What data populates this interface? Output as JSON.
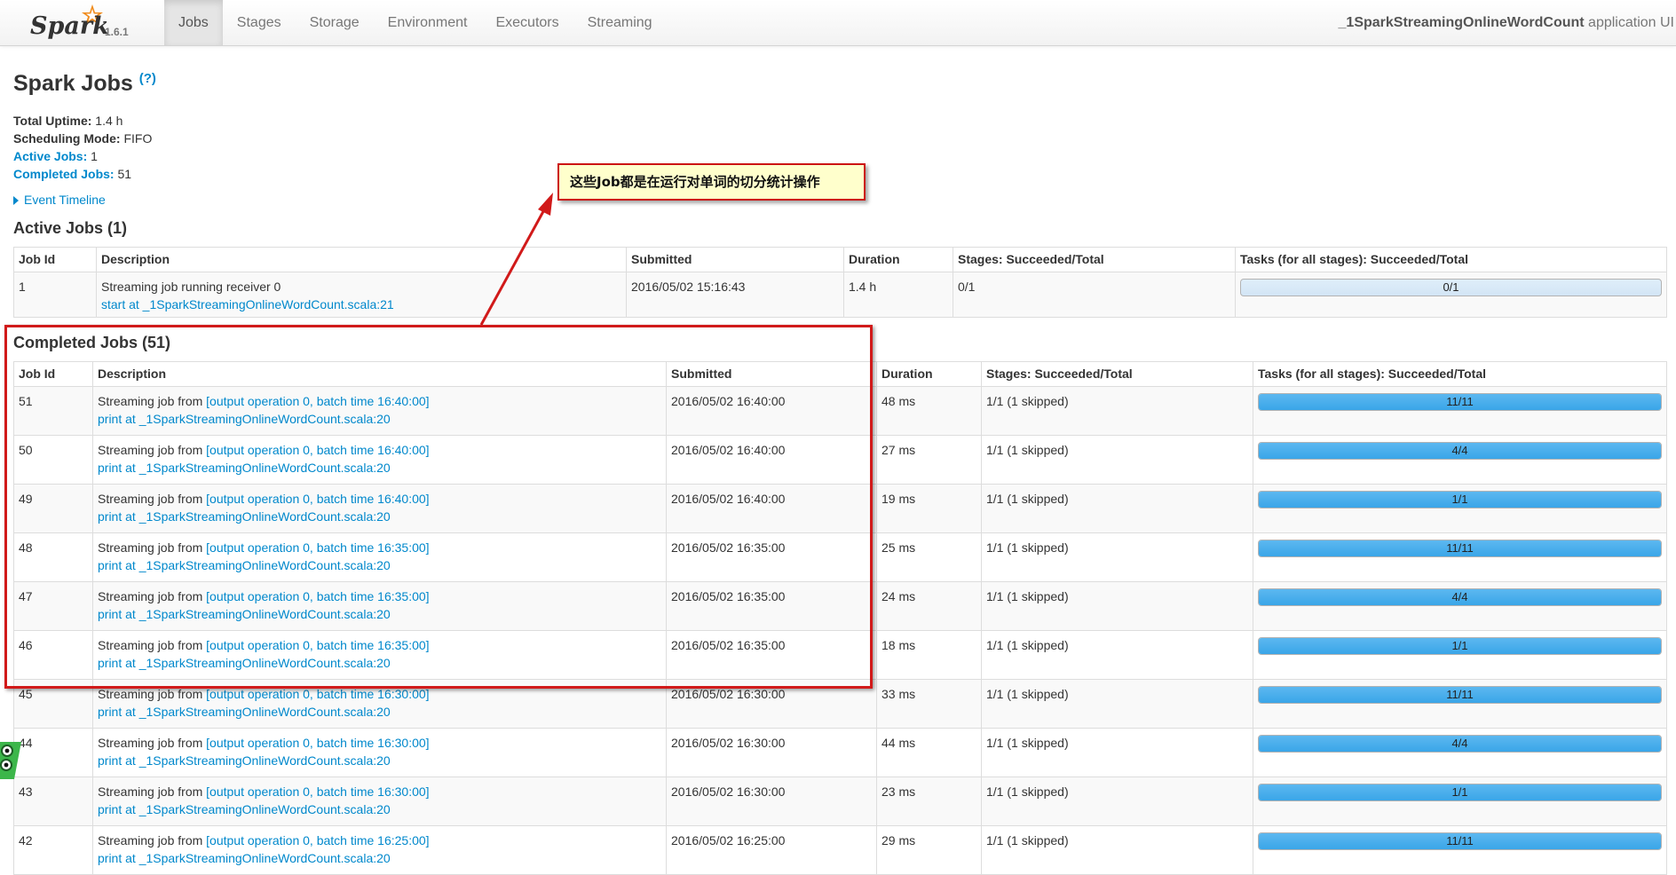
{
  "navbar": {
    "brand": "Spark",
    "version": "1.6.1",
    "tabs": [
      {
        "label": "Jobs",
        "active": true
      },
      {
        "label": "Stages",
        "active": false
      },
      {
        "label": "Storage",
        "active": false
      },
      {
        "label": "Environment",
        "active": false
      },
      {
        "label": "Executors",
        "active": false
      },
      {
        "label": "Streaming",
        "active": false
      }
    ],
    "app_name": "_1SparkStreamingOnlineWordCount",
    "app_suffix": "application UI"
  },
  "page": {
    "title": "Spark Jobs",
    "help": "(?)",
    "summary": {
      "uptime_label": "Total Uptime:",
      "uptime_value": "1.4 h",
      "mode_label": "Scheduling Mode:",
      "mode_value": "FIFO",
      "active_label": "Active Jobs:",
      "active_value": "1",
      "completed_label": "Completed Jobs:",
      "completed_value": "51"
    },
    "timeline_label": "Event Timeline"
  },
  "columns": {
    "job_id": "Job Id",
    "description": "Description",
    "submitted": "Submitted",
    "duration": "Duration",
    "stages": "Stages: Succeeded/Total",
    "tasks": "Tasks (for all stages): Succeeded/Total"
  },
  "active_jobs": {
    "title": "Active Jobs (1)",
    "rows": [
      {
        "id": "1",
        "desc_text": "Streaming job running receiver 0",
        "desc_link": "start at _1SparkStreamingOnlineWordCount.scala:21",
        "submitted": "2016/05/02 15:16:43",
        "duration": "1.4 h",
        "stages": "0/1",
        "tasks": "0/1",
        "progress": 0
      }
    ]
  },
  "completed_jobs": {
    "title": "Completed Jobs (51)",
    "rows": [
      {
        "id": "51",
        "desc_prefix": "Streaming job from ",
        "desc_batch": "[output operation 0, batch time 16:40:00]",
        "desc_link": "print at _1SparkStreamingOnlineWordCount.scala:20",
        "submitted": "2016/05/02 16:40:00",
        "duration": "48 ms",
        "stages": "1/1 (1 skipped)",
        "tasks": "11/11",
        "progress": 1
      },
      {
        "id": "50",
        "desc_prefix": "Streaming job from ",
        "desc_batch": "[output operation 0, batch time 16:40:00]",
        "desc_link": "print at _1SparkStreamingOnlineWordCount.scala:20",
        "submitted": "2016/05/02 16:40:00",
        "duration": "27 ms",
        "stages": "1/1 (1 skipped)",
        "tasks": "4/4",
        "progress": 1
      },
      {
        "id": "49",
        "desc_prefix": "Streaming job from ",
        "desc_batch": "[output operation 0, batch time 16:40:00]",
        "desc_link": "print at _1SparkStreamingOnlineWordCount.scala:20",
        "submitted": "2016/05/02 16:40:00",
        "duration": "19 ms",
        "stages": "1/1 (1 skipped)",
        "tasks": "1/1",
        "progress": 1
      },
      {
        "id": "48",
        "desc_prefix": "Streaming job from ",
        "desc_batch": "[output operation 0, batch time 16:35:00]",
        "desc_link": "print at _1SparkStreamingOnlineWordCount.scala:20",
        "submitted": "2016/05/02 16:35:00",
        "duration": "25 ms",
        "stages": "1/1 (1 skipped)",
        "tasks": "11/11",
        "progress": 1
      },
      {
        "id": "47",
        "desc_prefix": "Streaming job from ",
        "desc_batch": "[output operation 0, batch time 16:35:00]",
        "desc_link": "print at _1SparkStreamingOnlineWordCount.scala:20",
        "submitted": "2016/05/02 16:35:00",
        "duration": "24 ms",
        "stages": "1/1 (1 skipped)",
        "tasks": "4/4",
        "progress": 1
      },
      {
        "id": "46",
        "desc_prefix": "Streaming job from ",
        "desc_batch": "[output operation 0, batch time 16:35:00]",
        "desc_link": "print at _1SparkStreamingOnlineWordCount.scala:20",
        "submitted": "2016/05/02 16:35:00",
        "duration": "18 ms",
        "stages": "1/1 (1 skipped)",
        "tasks": "1/1",
        "progress": 1
      },
      {
        "id": "45",
        "desc_prefix": "Streaming job from ",
        "desc_batch": "[output operation 0, batch time 16:30:00]",
        "desc_link": "print at _1SparkStreamingOnlineWordCount.scala:20",
        "submitted": "2016/05/02 16:30:00",
        "duration": "33 ms",
        "stages": "1/1 (1 skipped)",
        "tasks": "11/11",
        "progress": 1
      },
      {
        "id": "44",
        "desc_prefix": "Streaming job from ",
        "desc_batch": "[output operation 0, batch time 16:30:00]",
        "desc_link": "print at _1SparkStreamingOnlineWordCount.scala:20",
        "submitted": "2016/05/02 16:30:00",
        "duration": "44 ms",
        "stages": "1/1 (1 skipped)",
        "tasks": "4/4",
        "progress": 1
      },
      {
        "id": "43",
        "desc_prefix": "Streaming job from ",
        "desc_batch": "[output operation 0, batch time 16:30:00]",
        "desc_link": "print at _1SparkStreamingOnlineWordCount.scala:20",
        "submitted": "2016/05/02 16:30:00",
        "duration": "23 ms",
        "stages": "1/1 (1 skipped)",
        "tasks": "1/1",
        "progress": 1
      },
      {
        "id": "42",
        "desc_prefix": "Streaming job from ",
        "desc_batch": "[output operation 0, batch time 16:25:00]",
        "desc_link": "print at _1SparkStreamingOnlineWordCount.scala:20",
        "submitted": "2016/05/02 16:25:00",
        "duration": "29 ms",
        "stages": "1/1 (1 skipped)",
        "tasks": "11/11",
        "progress": 1
      }
    ]
  },
  "annotation": {
    "callout_text": "这些Job都是在运行对单词的切分统计操作"
  },
  "icons": {
    "logo": "spark-star-icon",
    "help": "help-icon",
    "timeline": "caret-right-icon",
    "mascot": "mascot-icon"
  },
  "colors": {
    "link": "#0088cc",
    "progress_fill": "#3aa6e8",
    "annotation_red": "#d11a1a",
    "callout_bg": "#ffffcc"
  }
}
